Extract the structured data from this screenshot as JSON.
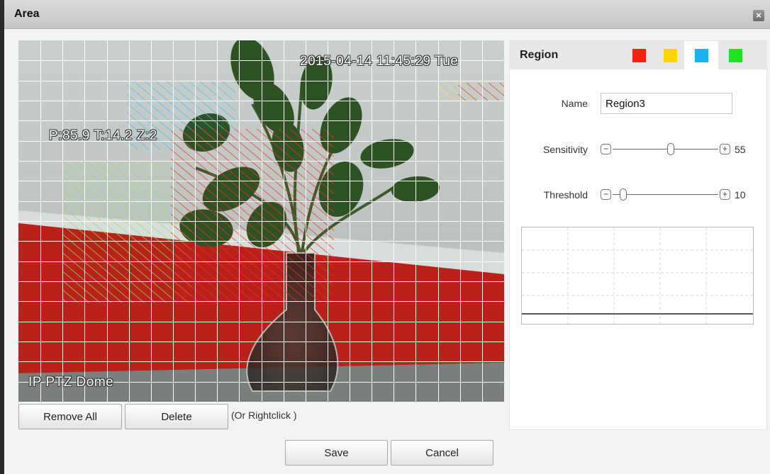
{
  "window": {
    "title": "Area",
    "close_icon": "×"
  },
  "video": {
    "timestamp": "2015-04-14 11:45:29 Tue",
    "ptz_readout": "P:85.9 T:14.2 Z:2",
    "camera_name": "IP PTZ Dome"
  },
  "actions": {
    "remove_all_label": "Remove All",
    "delete_label": "Delete",
    "hint": "(Or Rightclick )",
    "save_label": "Save",
    "cancel_label": "Cancel"
  },
  "region_panel": {
    "title": "Region",
    "swatches": [
      {
        "name": "red-region",
        "color": "#f0240a"
      },
      {
        "name": "yellow-region",
        "color": "#ffd400"
      },
      {
        "name": "blue-region",
        "color": "#1ab2f0",
        "active": true
      },
      {
        "name": "green-region",
        "color": "#22e022"
      }
    ],
    "name_label": "Name",
    "name_value": "Region3",
    "sensitivity_label": "Sensitivity",
    "sensitivity_value": "55",
    "sensitivity_min_icon": "minus-icon",
    "sensitivity_max_icon": "plus-icon",
    "threshold_label": "Threshold",
    "threshold_value": "10"
  }
}
